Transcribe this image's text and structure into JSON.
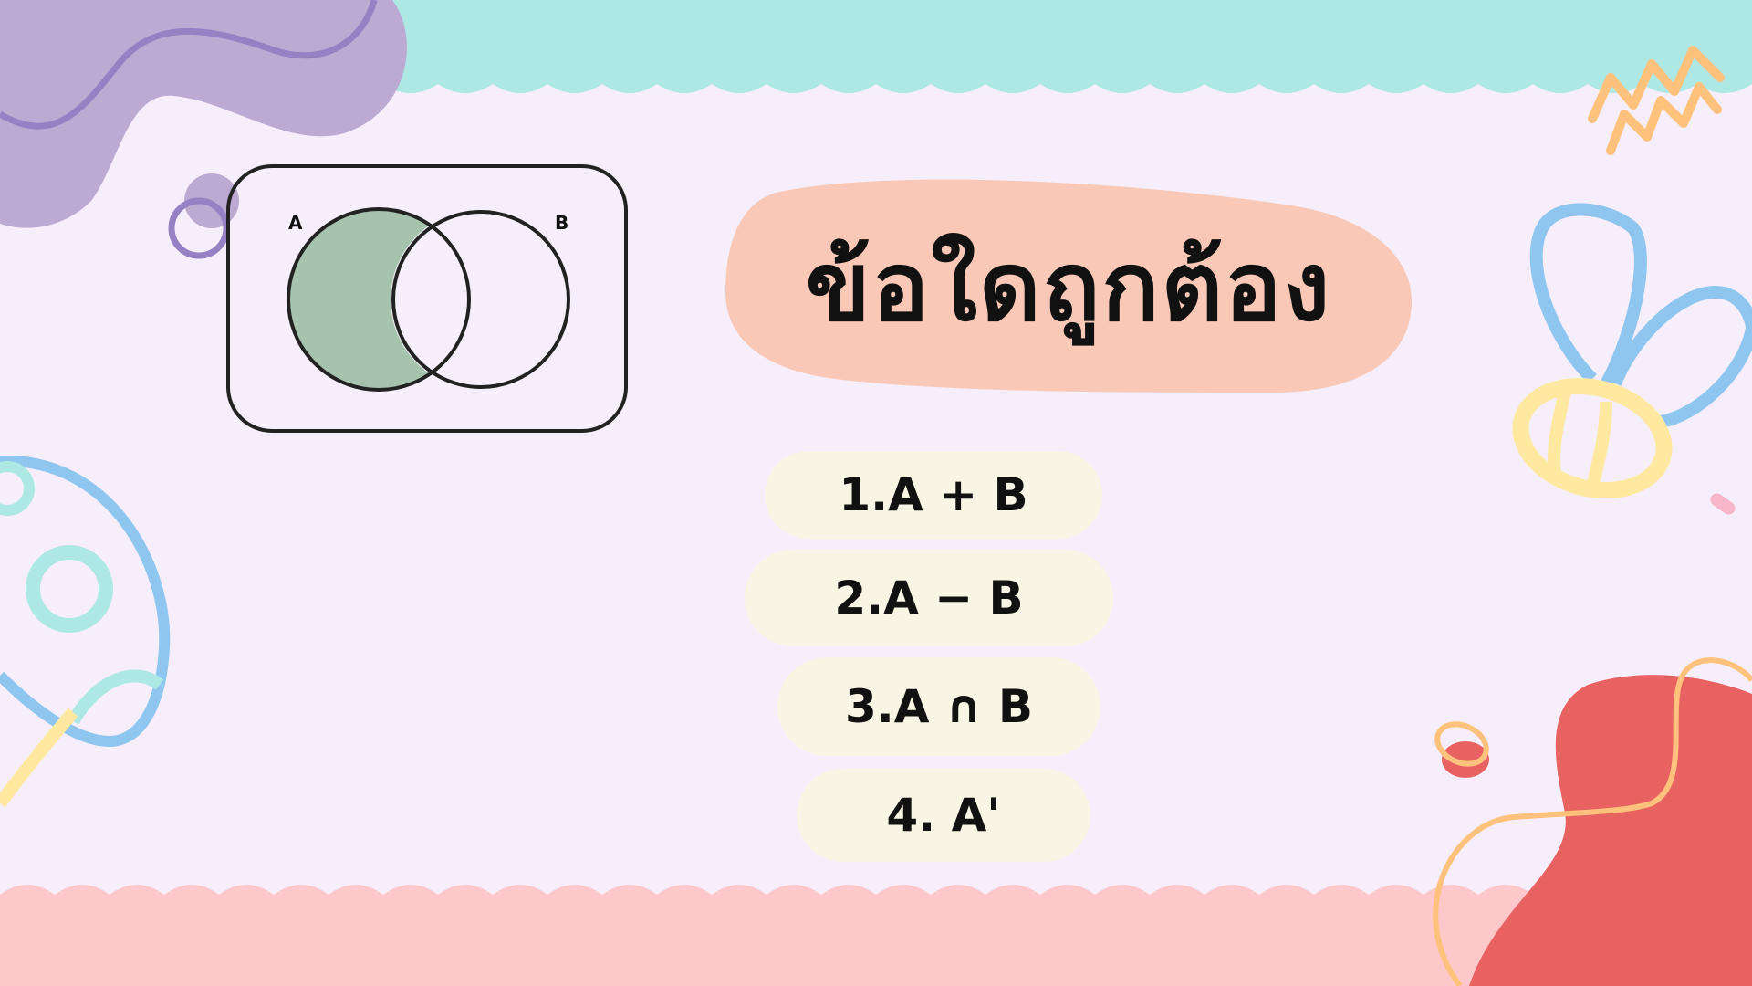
{
  "title": "ข้อใดถูกต้อง",
  "venn": {
    "label_a": "A",
    "label_b": "B",
    "shaded_region": "A only (A - B)",
    "shade_color": "#a6c4ad",
    "frame_color": "#222222"
  },
  "options": [
    {
      "text": "1.A + B"
    },
    {
      "text": "2.A − B"
    },
    {
      "text": "3.A ∩ B"
    },
    {
      "text": "4. A'"
    }
  ],
  "colors": {
    "background": "#f6effb",
    "top_band": "#ade8e4",
    "bottom_band": "#fec8cb",
    "title_pill": "#f9c8b6",
    "option_pill": "#f8f5e4",
    "purple_blob": "#bdaad3",
    "red_blob": "#e96262",
    "blue_stroke": "#8fc6ef",
    "yellow_stroke": "#ffe9a0",
    "orange_stroke": "#ffc27c"
  }
}
